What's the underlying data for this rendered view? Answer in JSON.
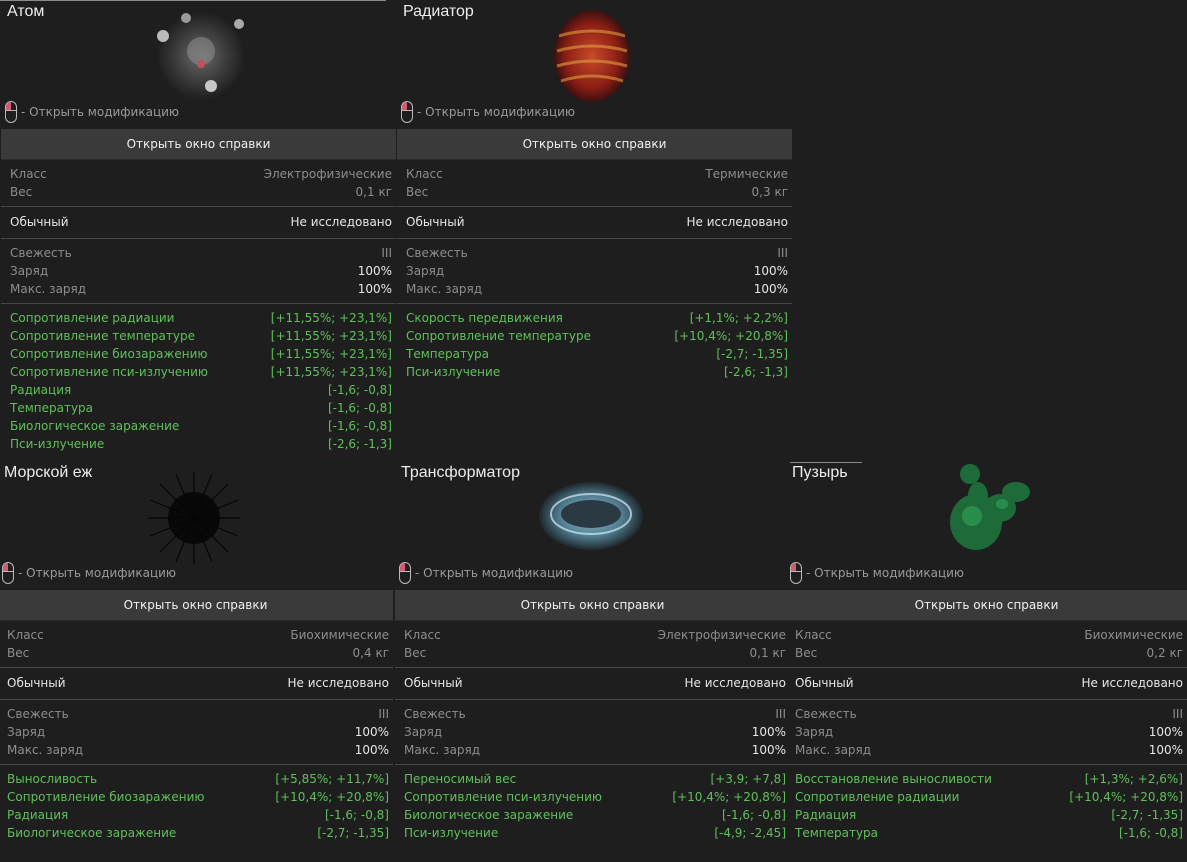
{
  "ui": {
    "open_mod": "- Открыть модификацию",
    "open_help": "Открыть окно справки",
    "class_label": "Класс",
    "weight_label": "Вес",
    "freshness_label": "Свежесть",
    "charge_label": "Заряд",
    "max_charge_label": "Макс. заряд"
  },
  "cards": [
    {
      "name": "Атом",
      "class": "Электрофизические",
      "weight": "0,1 кг",
      "rarity": "Обычный",
      "research": "Не исследовано",
      "freshness": "III",
      "charge": "100%",
      "max_charge": "100%",
      "stats": [
        {
          "k": "Сопротивление радиации",
          "v": "[+11,55%; +23,1%]"
        },
        {
          "k": "Сопротивление температуре",
          "v": "[+11,55%; +23,1%]"
        },
        {
          "k": "Сопротивление биозаражению",
          "v": "[+11,55%; +23,1%]"
        },
        {
          "k": "Сопротивление пси-излучению",
          "v": "[+11,55%; +23,1%]"
        },
        {
          "k": "Радиация",
          "v": "[-1,6; -0,8]"
        },
        {
          "k": "Температура",
          "v": "[-1,6; -0,8]"
        },
        {
          "k": "Биологическое заражение",
          "v": "[-1,6; -0,8]"
        },
        {
          "k": "Пси-излучение",
          "v": "[-2,6; -1,3]"
        }
      ]
    },
    {
      "name": "Радиатор",
      "class": "Термические",
      "weight": "0,3 кг",
      "rarity": "Обычный",
      "research": "Не исследовано",
      "freshness": "III",
      "charge": "100%",
      "max_charge": "100%",
      "stats": [
        {
          "k": "Скорость передвижения",
          "v": "[+1,1%; +2,2%]"
        },
        {
          "k": "Сопротивление температуре",
          "v": "[+10,4%; +20,8%]"
        },
        {
          "k": "Температура",
          "v": "[-2,7; -1,35]"
        },
        {
          "k": "Пси-излучение",
          "v": "[-2,6; -1,3]"
        }
      ]
    },
    {
      "name": "Морской еж",
      "class": "Биохимические",
      "weight": "0,4 кг",
      "rarity": "Обычный",
      "research": "Не исследовано",
      "freshness": "III",
      "charge": "100%",
      "max_charge": "100%",
      "stats": [
        {
          "k": "Выносливость",
          "v": "[+5,85%; +11,7%]"
        },
        {
          "k": "Сопротивление биозаражению",
          "v": "[+10,4%; +20,8%]"
        },
        {
          "k": "Радиация",
          "v": "[-1,6; -0,8]"
        },
        {
          "k": "Биологическое заражение",
          "v": "[-2,7; -1,35]"
        }
      ]
    },
    {
      "name": "Трансформатор",
      "class": "Электрофизические",
      "weight": "0,1 кг",
      "rarity": "Обычный",
      "research": "Не исследовано",
      "freshness": "III",
      "charge": "100%",
      "max_charge": "100%",
      "stats": [
        {
          "k": "Переносимый вес",
          "v": "[+3,9; +7,8]"
        },
        {
          "k": "Сопротивление пси-излучению",
          "v": "[+10,4%; +20,8%]"
        },
        {
          "k": "Биологическое заражение",
          "v": "[-1,6; -0,8]"
        },
        {
          "k": "Пси-излучение",
          "v": "[-4,9; -2,45]"
        }
      ]
    },
    {
      "name": "Пузырь",
      "class": "Биохимические",
      "weight": "0,2 кг",
      "rarity": "Обычный",
      "research": "Не исследовано",
      "freshness": "III",
      "charge": "100%",
      "max_charge": "100%",
      "stats": [
        {
          "k": "Восстановление выносливости",
          "v": "[+1,3%; +2,6%]"
        },
        {
          "k": "Сопротивление радиации",
          "v": "[+10,4%; +20,8%]"
        },
        {
          "k": "Радиация",
          "v": "[-2,7; -1,35]"
        },
        {
          "k": "Температура",
          "v": "[-1,6; -0,8]"
        }
      ]
    }
  ]
}
